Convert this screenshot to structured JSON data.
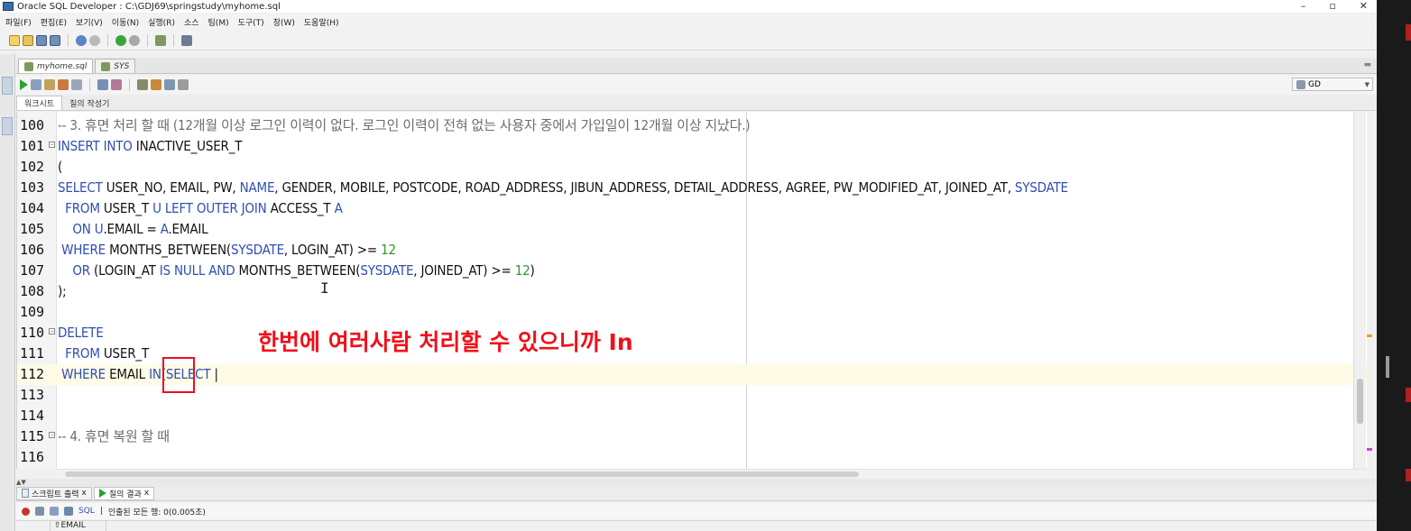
{
  "window": {
    "title": "Oracle SQL Developer : C:\\GDJ69\\springstudy\\myhome.sql",
    "min": "–",
    "restore": "▫",
    "close": "✕"
  },
  "menu": [
    "파일(F)",
    "편집(E)",
    "보기(V)",
    "이동(N)",
    "실행(R)",
    "소스",
    "팀(M)",
    "도구(T)",
    "창(W)",
    "도움말(H)"
  ],
  "doc_tabs": [
    {
      "label": "myhome.sql",
      "active": true
    },
    {
      "label": "SYS",
      "active": false
    }
  ],
  "connection": {
    "name": "GD"
  },
  "sub_tabs": [
    {
      "label": "워크시트",
      "active": true
    },
    {
      "label": "질의 작성기",
      "active": false
    }
  ],
  "lines": [
    {
      "n": "100",
      "fold": false,
      "tokens": [
        [
          "c",
          "-- 3. 휴면 처리 할 때 (12개월 이상 로그인 이력이 없다. 로그인 이력이 전혀 없는 사용자 중에서 가입일이 12개월 이상 지났다.)"
        ]
      ]
    },
    {
      "n": "101",
      "fold": true,
      "tokens": [
        [
          "k",
          "INSERT INTO"
        ],
        [
          "t",
          " INACTIVE_USER_T"
        ]
      ]
    },
    {
      "n": "102",
      "fold": false,
      "tokens": [
        [
          "t",
          "("
        ]
      ]
    },
    {
      "n": "103",
      "fold": false,
      "tokens": [
        [
          "k",
          "SELECT"
        ],
        [
          "t",
          " USER_NO, EMAIL, PW, "
        ],
        [
          "k",
          "NAME"
        ],
        [
          "t",
          ", GENDER, MOBILE, POSTCODE, ROAD_ADDRESS, JIBUN_ADDRESS, DETAIL_ADDRESS, AGREE, PW_MODIFIED_AT, JOINED_AT, "
        ],
        [
          "k",
          "SYSDATE"
        ]
      ]
    },
    {
      "n": "104",
      "fold": false,
      "tokens": [
        [
          "k",
          "  FROM"
        ],
        [
          "t",
          " USER_T "
        ],
        [
          "k",
          "U LEFT OUTER JOIN"
        ],
        [
          "t",
          " ACCESS_T "
        ],
        [
          "k",
          "A"
        ]
      ]
    },
    {
      "n": "105",
      "fold": false,
      "tokens": [
        [
          "k",
          "    ON"
        ],
        [
          "t",
          " "
        ],
        [
          "k",
          "U"
        ],
        [
          "t",
          ".EMAIL = "
        ],
        [
          "k",
          "A"
        ],
        [
          "t",
          ".EMAIL"
        ]
      ]
    },
    {
      "n": "106",
      "fold": false,
      "tokens": [
        [
          "k",
          " WHERE"
        ],
        [
          "t",
          " MONTHS_BETWEEN("
        ],
        [
          "k",
          "SYSDATE"
        ],
        [
          "t",
          ", LOGIN_AT) >= "
        ],
        [
          "n",
          "12"
        ]
      ]
    },
    {
      "n": "107",
      "fold": false,
      "tokens": [
        [
          "k",
          "    OR"
        ],
        [
          "t",
          " (LOGIN_AT "
        ],
        [
          "k",
          "IS NULL AND"
        ],
        [
          "t",
          " MONTHS_BETWEEN("
        ],
        [
          "k",
          "SYSDATE"
        ],
        [
          "t",
          ", JOINED_AT) >= "
        ],
        [
          "n",
          "12"
        ],
        [
          "t",
          ")"
        ]
      ]
    },
    {
      "n": "108",
      "fold": false,
      "tokens": [
        [
          "t",
          ");"
        ]
      ]
    },
    {
      "n": "109",
      "fold": false,
      "tokens": []
    },
    {
      "n": "110",
      "fold": true,
      "tokens": [
        [
          "k",
          "DELETE"
        ]
      ]
    },
    {
      "n": "111",
      "fold": false,
      "tokens": [
        [
          "k",
          "  FROM"
        ],
        [
          "t",
          " USER_T"
        ]
      ]
    },
    {
      "n": "112",
      "fold": false,
      "current": true,
      "tokens": [
        [
          "k",
          " WHERE"
        ],
        [
          "t",
          " EMAIL "
        ],
        [
          "k",
          "IN"
        ],
        [
          "t",
          "("
        ],
        [
          "k",
          "SELECT"
        ],
        [
          "t",
          " |"
        ]
      ]
    },
    {
      "n": "113",
      "fold": false,
      "tokens": []
    },
    {
      "n": "114",
      "fold": false,
      "tokens": []
    },
    {
      "n": "115",
      "fold": true,
      "tokens": [
        [
          "c",
          "-- 4. 휴면 복원 할 때"
        ]
      ]
    },
    {
      "n": "116",
      "fold": false,
      "tokens": []
    }
  ],
  "annotation": "한번에 여러사람 처리할 수 있으니까 In",
  "bottom_tabs": [
    {
      "label": "스크립트 출력",
      "close": "x",
      "active": false
    },
    {
      "label": "질의 결과",
      "close": "x",
      "active": true
    }
  ],
  "result": {
    "sql_label": "SQL",
    "status": "인출된 모든 행: 0(0.005초)",
    "column": "EMAIL"
  },
  "colors": {
    "keyword": "#2f4fb0",
    "comment": "#6d6d6d",
    "number": "#2a9a2a",
    "annotation": "#f0101a"
  }
}
